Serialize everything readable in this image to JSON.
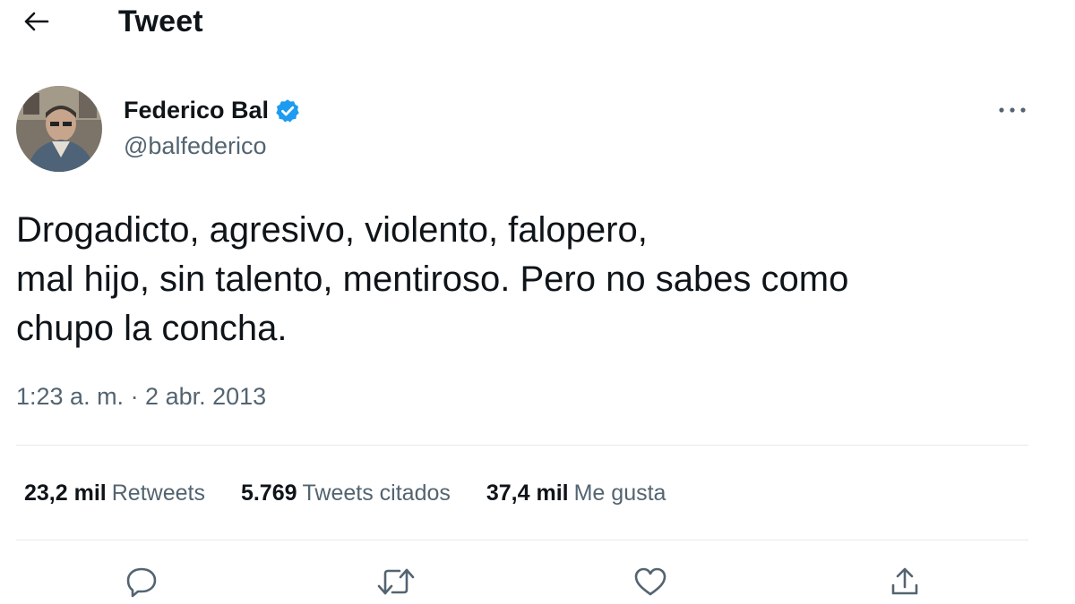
{
  "header": {
    "title": "Tweet"
  },
  "author": {
    "display_name": "Federico Bal",
    "handle": "@balfederico",
    "verified": true
  },
  "tweet": {
    "lines": [
      "Drogadicto, agresivo, violento, falopero,",
      "mal hijo, sin talento, mentiroso. Pero no sabes como",
      "chupo la concha."
    ],
    "timestamp": "1:23 a. m. · 2 abr. 2013"
  },
  "stats": {
    "retweets": {
      "count": "23,2 mil",
      "label": "Retweets"
    },
    "quotes": {
      "count": "5.769",
      "label": "Tweets citados"
    },
    "likes": {
      "count": "37,4 mil",
      "label": "Me gusta"
    }
  },
  "icons": {
    "back": "arrow-left-icon",
    "verified": "verified-badge-icon",
    "more": "more-horizontal-icon",
    "reply": "reply-icon",
    "retweet": "retweet-icon",
    "like": "heart-icon",
    "share": "share-icon"
  },
  "colors": {
    "verified": "#1d9bf0",
    "text": "#0f1419",
    "secondary": "#536471",
    "divider": "#e7e9ea"
  }
}
